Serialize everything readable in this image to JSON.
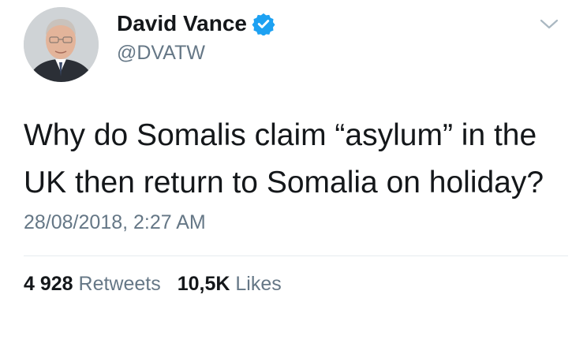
{
  "author": {
    "display_name": "David Vance",
    "handle": "@DVATW",
    "verified": true,
    "verified_badge_color": "#1da1f2"
  },
  "tweet": {
    "text": "Why do Somalis claim “asylum” in the UK then return to Somalia on holiday?",
    "timestamp": "28/08/2018, 2:27 AM"
  },
  "stats": {
    "retweets_count": "4 928",
    "retweets_label": "Retweets",
    "likes_count": "10,5K",
    "likes_label": "Likes"
  },
  "icons": {
    "verified": "verified-badge-icon",
    "menu": "chevron-down-icon"
  },
  "colors": {
    "text_primary": "#14171a",
    "text_secondary": "#657786",
    "divider": "#e6ecf0"
  }
}
